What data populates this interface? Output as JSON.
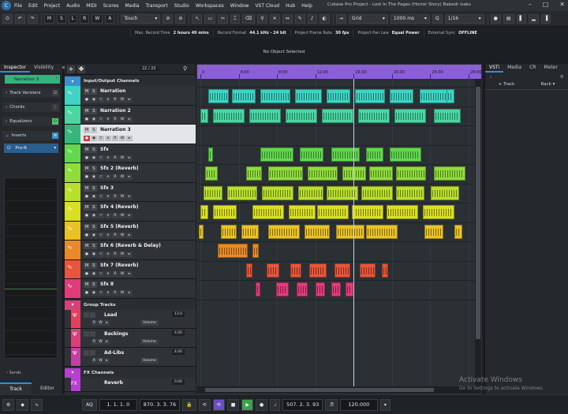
{
  "menu": [
    "File",
    "Edit",
    "Project",
    "Audio",
    "MIDI",
    "Scores",
    "Media",
    "Transport",
    "Studio",
    "Workspaces",
    "Window",
    "VST Cloud",
    "Hub",
    "Help"
  ],
  "window_title": "Cubase Pro Project - Lost In The Pages (Horror Story) Babedr isaks",
  "toolbar": {
    "modes": [
      "M",
      "S",
      "L",
      "R",
      "W",
      "A"
    ],
    "touch": "Touch",
    "grid": "Grid",
    "grid_value": "1000 ms",
    "quantize": "1/16"
  },
  "infoline": [
    {
      "label": "Max. Record Time",
      "value": "2 hours 49 mins"
    },
    {
      "label": "Record Format",
      "value": "44.1 kHz - 24 bit"
    },
    {
      "label": "Project Frame Rate",
      "value": "30 fps"
    },
    {
      "label": "Project Pan Law",
      "value": "Equal Power"
    },
    {
      "label": "External Sync",
      "value": "OFFLINE"
    }
  ],
  "status": "No Object Selected",
  "left": {
    "tabs": [
      "Inspector",
      "Visibility"
    ],
    "track_name": "Narration 3",
    "sections": [
      "Track Versions",
      "Chords",
      "Equalizers",
      "Inserts"
    ],
    "insert": "Pro-R",
    "sends": "Sends",
    "bottom_tabs": [
      "Track",
      "Editor"
    ]
  },
  "tracklist": {
    "header_count": "22 / 22",
    "folder_io": "Input/Output Channels",
    "tracks": [
      {
        "name": "Narration",
        "color": "#3fd3c4"
      },
      {
        "name": "Narration 2",
        "color": "#49d6a3"
      },
      {
        "name": "Narration 3",
        "color": "#36b57c"
      },
      {
        "name": "Sfx",
        "color": "#62d84e"
      },
      {
        "name": "Sfx 2 (Reverb)",
        "color": "#8fdc3b"
      },
      {
        "name": "Sfx 3",
        "color": "#b9df2c"
      },
      {
        "name": "Sfx 4 (Reverb)",
        "color": "#d9df25"
      },
      {
        "name": "Sfx 5 (Reverb)",
        "color": "#e8c227"
      },
      {
        "name": "Sfx 6 (Reverb & Delay)",
        "color": "#e98a2a"
      },
      {
        "name": "Sfx 7 (Reverb)",
        "color": "#e8553a"
      },
      {
        "name": "Sfx 8",
        "color": "#e23b7a"
      }
    ],
    "group_folder": "Group Tracks",
    "groups": [
      {
        "name": "Lead",
        "val": "13.0",
        "val2": "",
        "vol": "Volume",
        "color": "#e33f5e"
      },
      {
        "name": "Backings",
        "val": "4.00",
        "val2": "",
        "vol": "Volume",
        "color": "#d9407a"
      },
      {
        "name": "Ad-Libs",
        "val": "4.00",
        "val2": "",
        "vol": "Volume",
        "color": "#c43fa0"
      }
    ],
    "fx_folder": "FX Channels",
    "fx": [
      {
        "name": "Reverb",
        "val": "0.00",
        "color": "#b93ed2"
      }
    ]
  },
  "ruler": {
    "labels": [
      "0",
      "4:00",
      "8:00",
      "12:00",
      "16:00",
      "20:00",
      "24:00",
      "28:00"
    ]
  },
  "right": {
    "tabs": [
      "VSTi",
      "Media",
      "CR",
      "Meter"
    ],
    "cols": [
      "Track",
      "Rack"
    ]
  },
  "transport": {
    "aq": "AQ",
    "pos_left": "1. 1. 1. 0",
    "pos_right": "870. 3. 3. 76",
    "pos_main": "507. 2. 3. 93",
    "tempo": "120.000"
  },
  "watermark": {
    "title": "Activate Windows",
    "sub": "Go to Settings to activate Windows."
  },
  "colors": {
    "accent": "#2f8fd6",
    "ruler": "#8b5fd6",
    "record": "#c93b3b",
    "play": "#3aa34a"
  }
}
